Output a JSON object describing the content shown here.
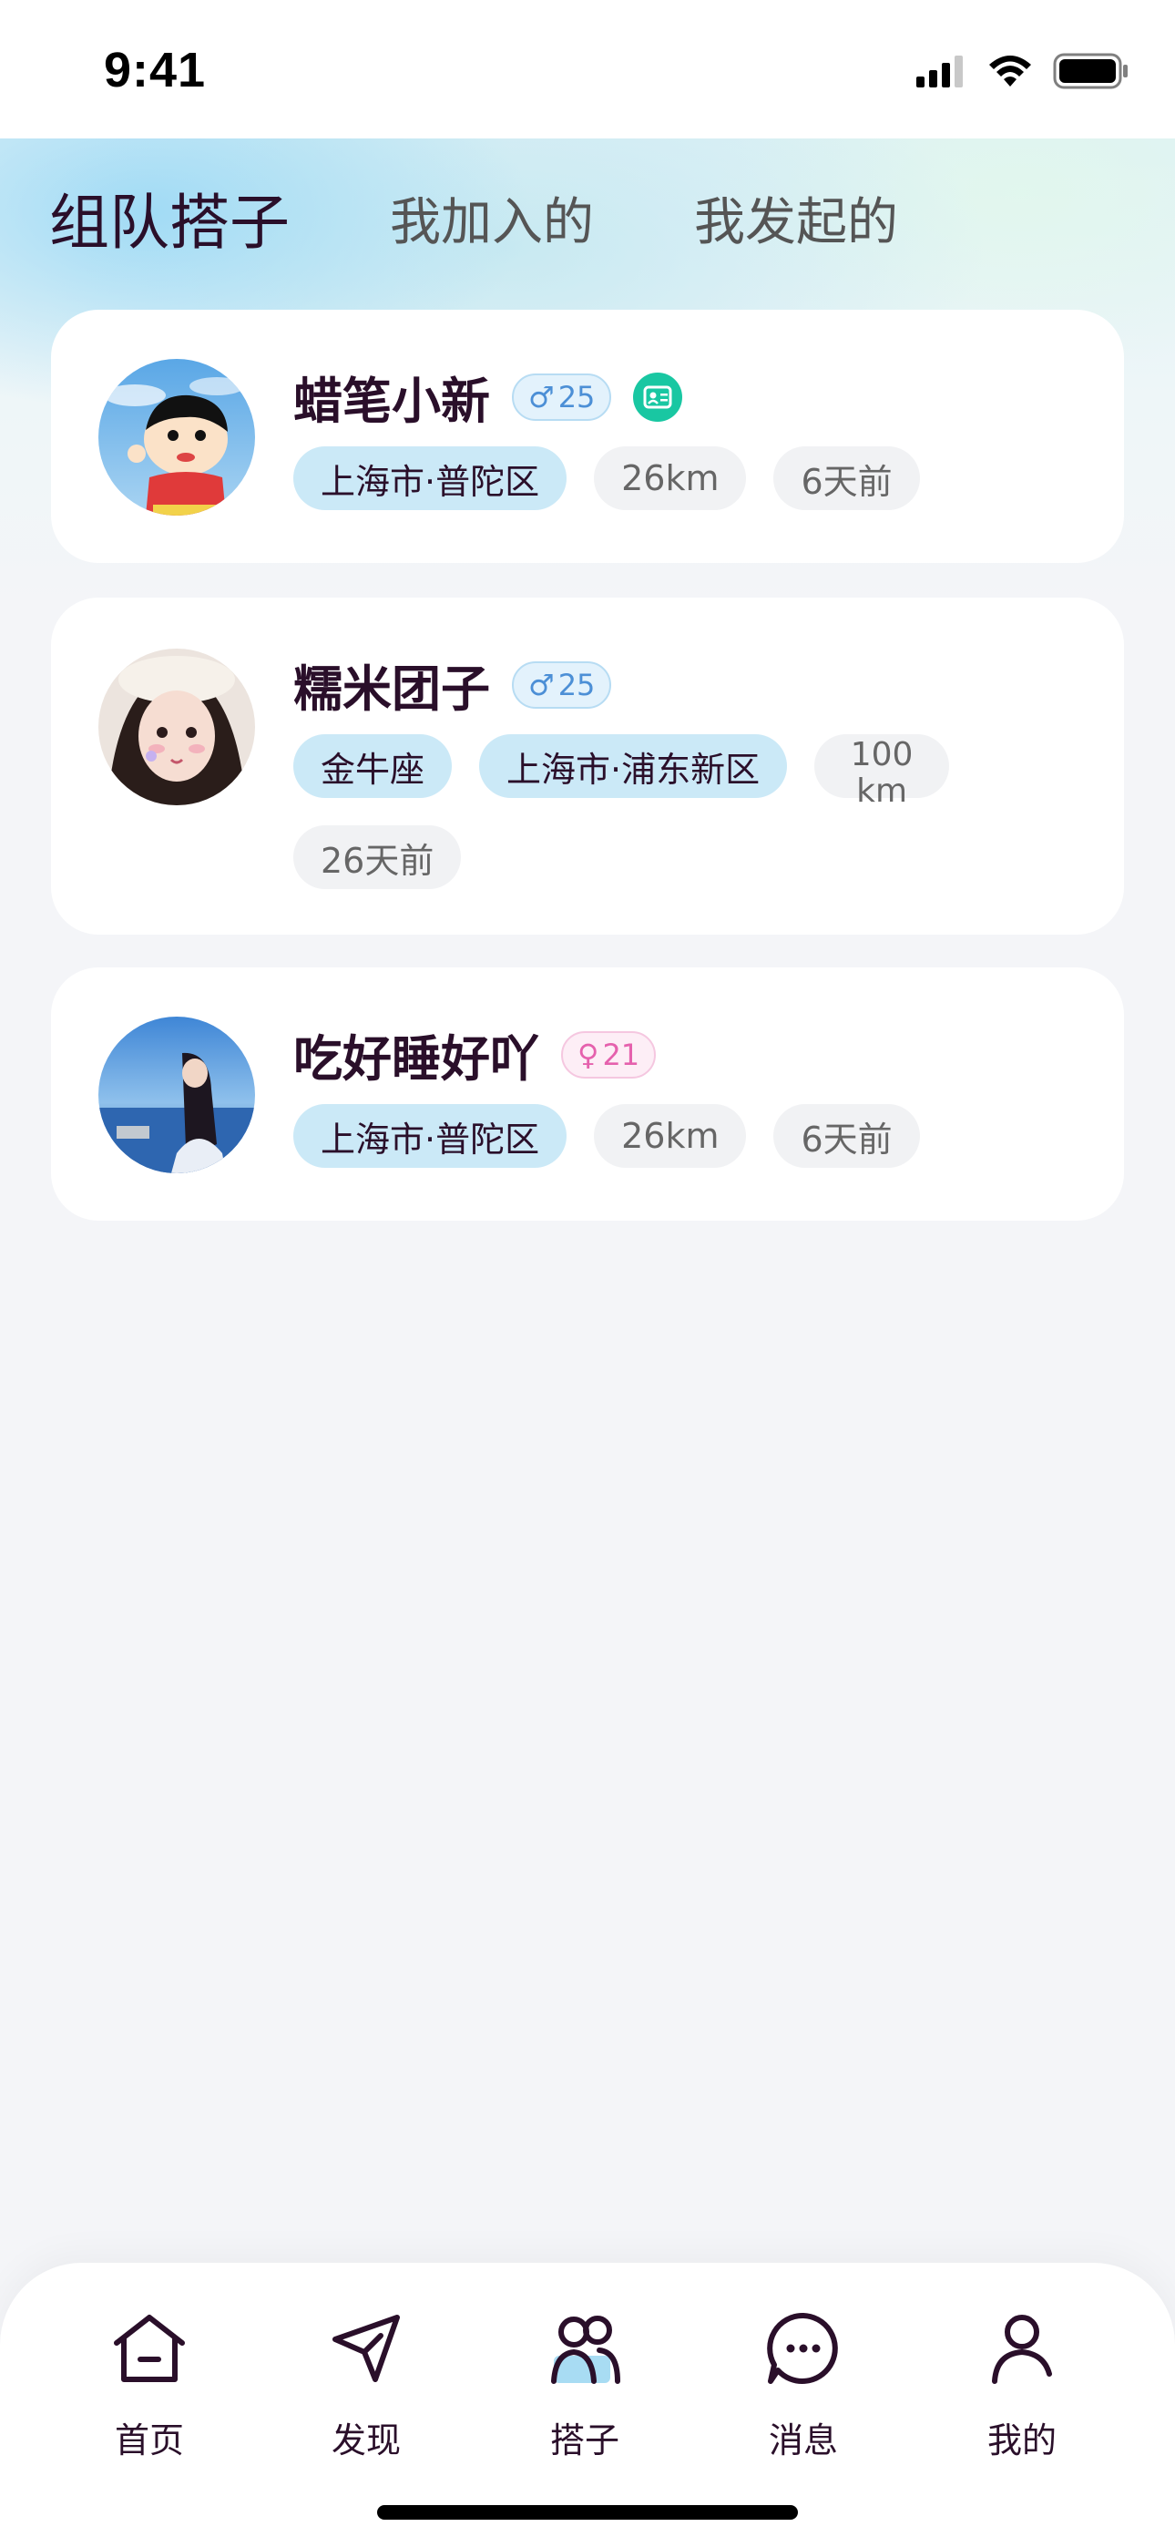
{
  "status_bar": {
    "time": "9:41"
  },
  "tabs": [
    {
      "label": "组队搭子",
      "active": true
    },
    {
      "label": "我加入的",
      "active": false
    },
    {
      "label": "我发起的",
      "active": false
    }
  ],
  "cards": [
    {
      "name": "蜡笔小新",
      "gender": "male",
      "gender_symbol": "♂",
      "age": "25",
      "verified_icon": "id-card-icon",
      "tags": {
        "location": "上海市·普陀区",
        "distance": "26km",
        "time": "6天前"
      }
    },
    {
      "name": "糯米团子",
      "gender": "male",
      "gender_symbol": "♂",
      "age": "25",
      "tags": {
        "zodiac": "金牛座",
        "location": "上海市·浦东新区",
        "distance": "100km",
        "time": "26天前"
      }
    },
    {
      "name": "吃好睡好吖",
      "gender": "female",
      "gender_symbol": "♀",
      "age": "21",
      "tags": {
        "location": "上海市·普陀区",
        "distance": "26km",
        "time": "6天前"
      }
    }
  ],
  "bottom_nav": [
    {
      "label": "首页",
      "icon": "home-icon"
    },
    {
      "label": "发现",
      "icon": "discover-icon"
    },
    {
      "label": "搭子",
      "icon": "partner-icon",
      "active": true
    },
    {
      "label": "消息",
      "icon": "message-icon"
    },
    {
      "label": "我的",
      "icon": "profile-icon"
    }
  ],
  "colors": {
    "accent_blue": "#cbe9f7",
    "male_blue": "#4c8fd6",
    "female_pink": "#e561ad",
    "verify_green": "#19c7a2",
    "text_dark": "#2a0f2a"
  }
}
